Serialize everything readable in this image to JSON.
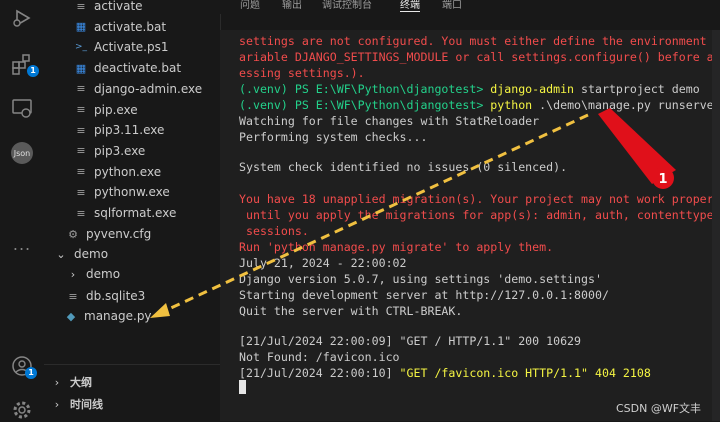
{
  "activity_bar": {
    "icons": [
      "run-debug-icon",
      "extensions-icon",
      "remote-explorer-icon",
      "json-icon",
      "more-icon",
      "account-icon",
      "settings-icon"
    ],
    "extensions_badge": "1",
    "account_badge": "1",
    "json_label": "Json",
    "more_label": "..."
  },
  "sidebar": {
    "files": [
      {
        "label": "activate",
        "icon": "file-icon"
      },
      {
        "label": "activate.bat",
        "icon": "windows-icon"
      },
      {
        "label": "Activate.ps1",
        "icon": "powershell-icon"
      },
      {
        "label": "deactivate.bat",
        "icon": "windows-icon"
      },
      {
        "label": "django-admin.exe",
        "icon": "file-icon"
      },
      {
        "label": "pip.exe",
        "icon": "file-icon"
      },
      {
        "label": "pip3.11.exe",
        "icon": "file-icon"
      },
      {
        "label": "pip3.exe",
        "icon": "file-icon"
      },
      {
        "label": "python.exe",
        "icon": "file-icon"
      },
      {
        "label": "pythonw.exe",
        "icon": "file-icon"
      },
      {
        "label": "sqlformat.exe",
        "icon": "file-icon"
      }
    ],
    "pyvenv": "pyvenv.cfg",
    "demo_folder": "demo",
    "demo_subfolder": "demo",
    "db": "db.sqlite3",
    "manage": "manage.py",
    "outline": "大纲",
    "timeline": "时间线"
  },
  "panel": {
    "tabs": [
      "问题",
      "输出",
      "调试控制台",
      "终端",
      "端口"
    ],
    "active_tab": "终端"
  },
  "terminal": {
    "l1": "settings are not configured. You must either define the environment v",
    "l2": "ariable DJANGO_SETTINGS_MODULE or call settings.configure() before acc",
    "l3": "essing settings.).",
    "l4_prompt": "(.venv) PS E:\\WF\\Python\\djangotest> ",
    "l4_cmd": "django-admin",
    "l4_args": " startproject demo",
    "l5_prompt": "(.venv) PS E:\\WF\\Python\\djangotest> ",
    "l5_cmd": "python",
    "l5_args": " .\\demo\\manage.py runserver",
    "l6": "Watching for file changes with StatReloader",
    "l7": "Performing system checks...",
    "l8": "System check identified no issues (0 silenced).",
    "l9": "You have 18 unapplied migration(s). Your project may not work properly",
    "l10": " until you apply the migrations for app(s): admin, auth, contenttypes,",
    "l11": " sessions.",
    "l12": "Run 'python manage.py migrate' to apply them.",
    "l13": "July 21, 2024 - 22:00:02",
    "l14": "Django version 5.0.7, using settings 'demo.settings'",
    "l15": "Starting development server at http://127.0.0.1:8000/",
    "l16": "Quit the server with CTRL-BREAK.",
    "l17": "[21/Jul/2024 22:00:09] \"GET / HTTP/1.1\" 200 10629",
    "l18": "Not Found: /favicon.ico",
    "l19_a": "[21/Jul/2024 22:00:10] ",
    "l19_b": "\"GET /favicon.ico HTTP/1.1\" 404 2108"
  },
  "annotation": {
    "number": "1",
    "arrow_color": "#f0c040",
    "marker_color": "#e0101a"
  },
  "watermark": "CSDN @WF文丰"
}
